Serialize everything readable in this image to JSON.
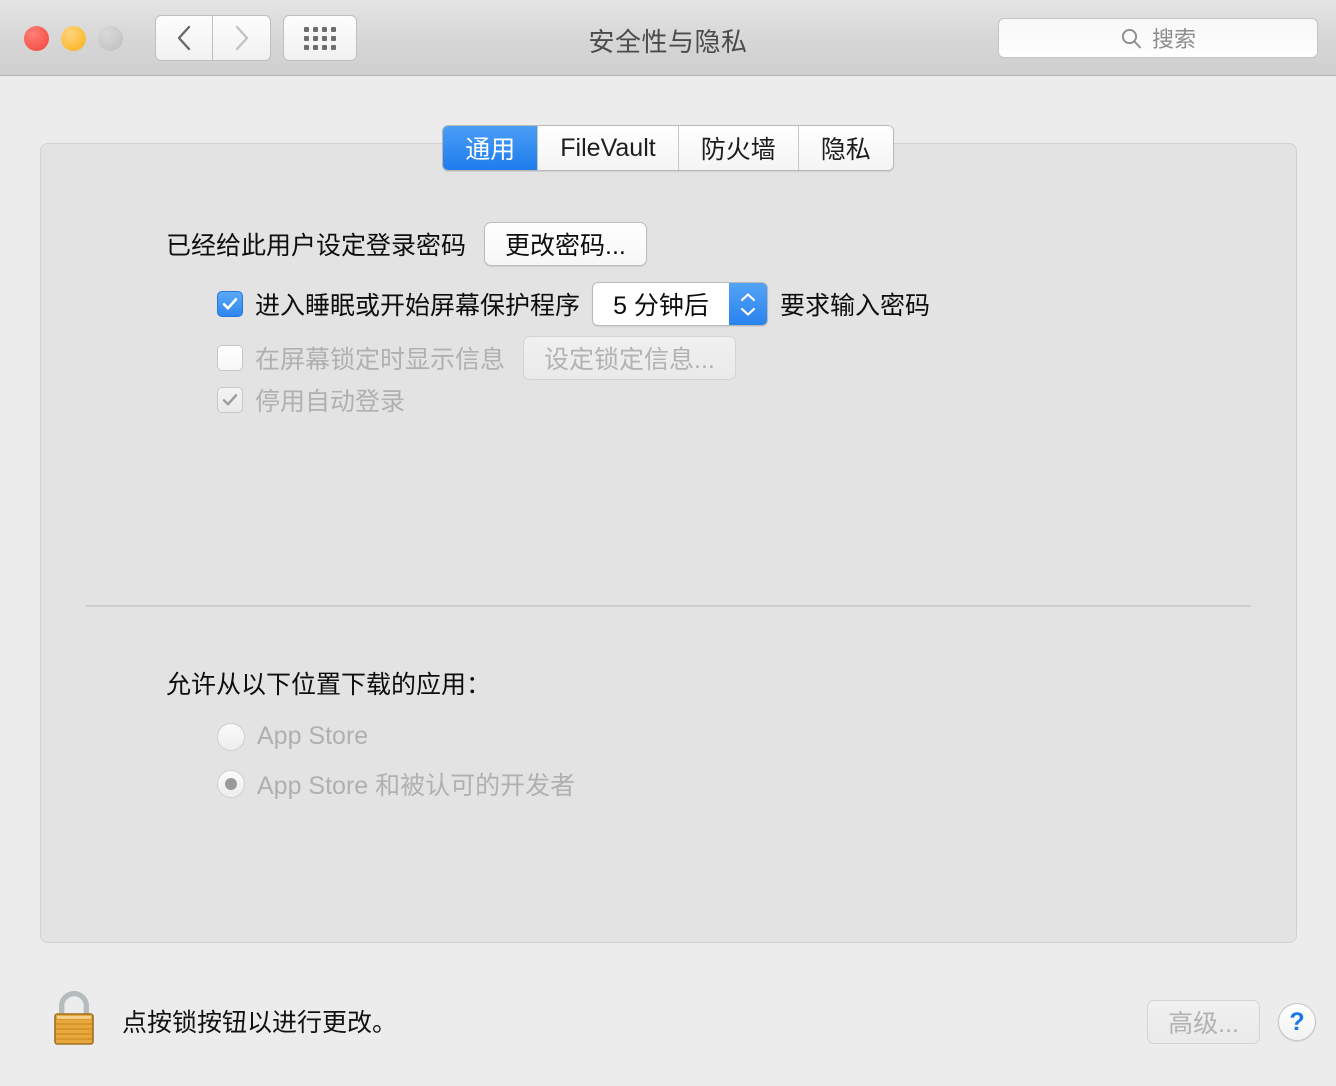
{
  "window": {
    "title": "安全性与隐私",
    "traffic_lights": [
      {
        "name": "close",
        "color": "#f6564c"
      },
      {
        "name": "minimize",
        "color": "#fbbc32"
      },
      {
        "name": "zoom",
        "color": "#c6c6c6"
      }
    ]
  },
  "toolbar": {
    "back_icon": "chevron-left-icon",
    "forward_icon": "chevron-right-icon",
    "show_all_icon": "grid-dots-icon"
  },
  "search": {
    "icon": "search-icon",
    "placeholder": "搜索",
    "value": ""
  },
  "tabs": [
    {
      "label": "通用",
      "selected": true
    },
    {
      "label": "FileVault",
      "selected": false
    },
    {
      "label": "防火墙",
      "selected": false
    },
    {
      "label": "隐私",
      "selected": false
    }
  ],
  "general": {
    "password_status_label": "已经给此用户设定登录密码",
    "change_password_button": "更改密码...",
    "require_password": {
      "checkbox_state": "checked",
      "prefix_label": "进入睡眠或开始屏幕保护程序",
      "delay_value": "5 分钟后",
      "suffix_label": "要求输入密码",
      "stepper_icon": "stepper-up-down-icon"
    },
    "lock_message": {
      "checkbox_state": "unchecked",
      "label": "在屏幕锁定时显示信息",
      "button": "设定锁定信息...",
      "disabled": true
    },
    "disable_auto_login": {
      "checkbox_state": "checked-disabled",
      "label": "停用自动登录",
      "disabled": true
    }
  },
  "download_section": {
    "heading": "允许从以下位置下载的应用：",
    "options": [
      {
        "label": "App Store",
        "selected": false,
        "disabled": true
      },
      {
        "label": "App Store 和被认可的开发者",
        "selected": true,
        "disabled": true
      }
    ]
  },
  "footer": {
    "lock_icon": "padlock-locked-icon",
    "lock_text": "点按锁按钮以进行更改。",
    "advanced_button": "高级...",
    "advanced_disabled": true,
    "help_button": "?"
  },
  "colors": {
    "accent_blue": "#2f86ef",
    "window_bg": "#ececec",
    "panel_bg": "#e3e3e3",
    "lock_gold": "#e8a83c"
  }
}
